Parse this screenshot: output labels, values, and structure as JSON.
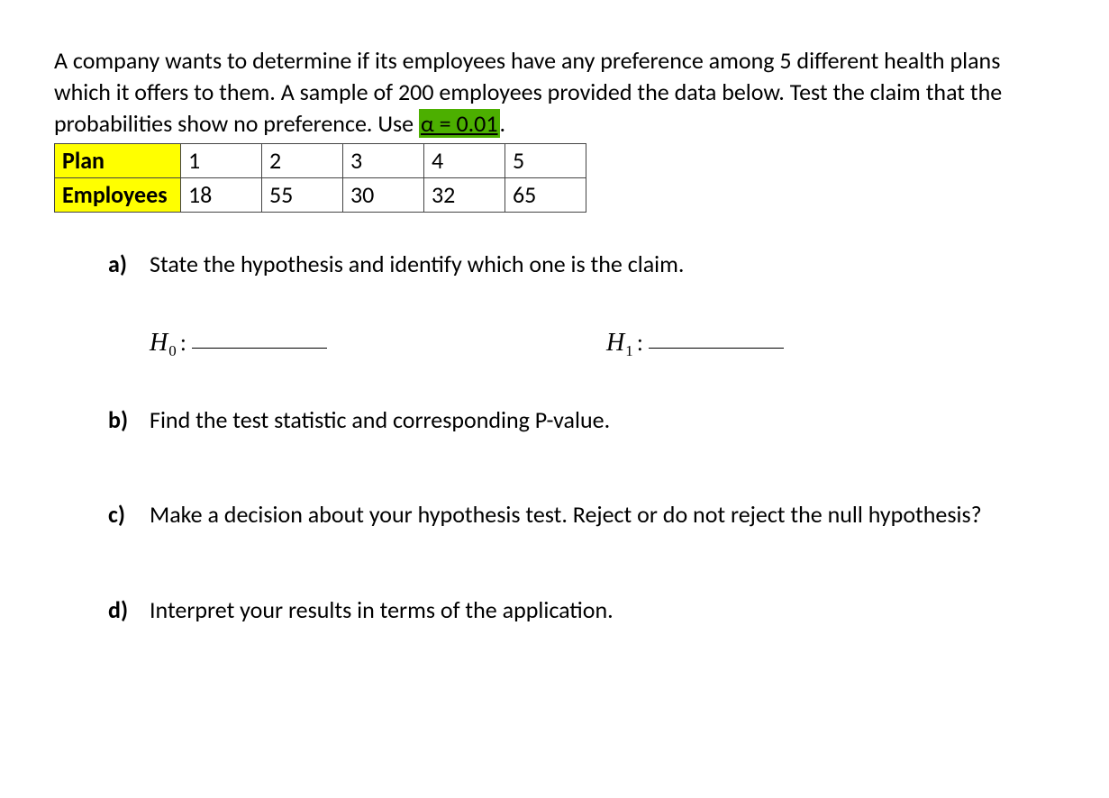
{
  "problem": {
    "text_before_highlight": "A company wants to determine if its employees have any preference among 5 different health plans which it offers to them. A sample of 200 employees provided the data below. Test the claim that the probabilities show no preference. Use ",
    "alpha_text": "α = 0.01",
    "text_after_highlight": "."
  },
  "table": {
    "row1_header": "Plan",
    "row1": [
      "1",
      "2",
      "3",
      "4",
      "5"
    ],
    "row2_header": "Employees",
    "row2": [
      "18",
      "55",
      "30",
      "32",
      "65"
    ]
  },
  "questions": {
    "a": {
      "label": "a)",
      "text": "State the hypothesis and identify which one is the claim."
    },
    "b": {
      "label": "b)",
      "text": "Find the test statistic and corresponding P-value."
    },
    "c": {
      "label": "c)",
      "text": "Make a decision about your hypothesis test.  Reject or do not reject the null hypothesis?"
    },
    "d": {
      "label": "d)",
      "text": "Interpret your results in terms of the application."
    }
  },
  "hypothesis": {
    "h0_symbol": "H",
    "h0_sub": "0",
    "h1_symbol": "H",
    "h1_sub": "1",
    "colon": ":"
  }
}
